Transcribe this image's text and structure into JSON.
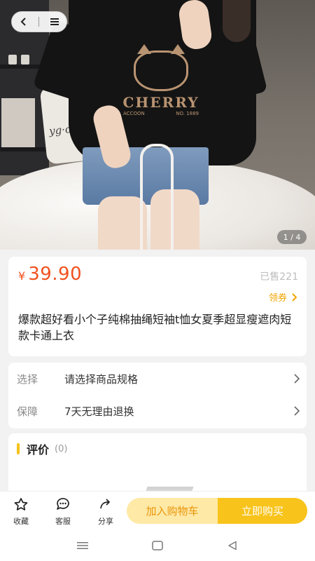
{
  "gallery": {
    "counter": "1 / 4",
    "print_word": "CHERRY",
    "print_sub_left": "ACCOON",
    "print_sub_right": "NO. 1889",
    "pillow_text": "yg·ol·on"
  },
  "product": {
    "currency": "¥",
    "price": "39.90",
    "sold": "已售221",
    "coupon": "领券",
    "title": "爆款超好看小个子纯棉抽绳短袖t恤女夏季超显瘦遮肉短款卡通上衣"
  },
  "spec": {
    "select_key": "选择",
    "select_value": "请选择商品规格",
    "guarantee_key": "保障",
    "guarantee_value": "7天无理由退换"
  },
  "review": {
    "title": "评价",
    "count": "(0)"
  },
  "actions": {
    "favorite": "收藏",
    "service": "客服",
    "share": "分享",
    "add_cart": "加入购物车",
    "buy_now": "立即购买"
  },
  "colors": {
    "price": "#f0521f",
    "accent": "#f8c31b",
    "coupon": "#f2a400"
  },
  "icons": [
    "back-icon",
    "menu-icon",
    "favorite-icon",
    "chat-icon",
    "share-icon",
    "chevron-right-icon",
    "recents-icon",
    "home-icon",
    "back-triangle-icon"
  ]
}
